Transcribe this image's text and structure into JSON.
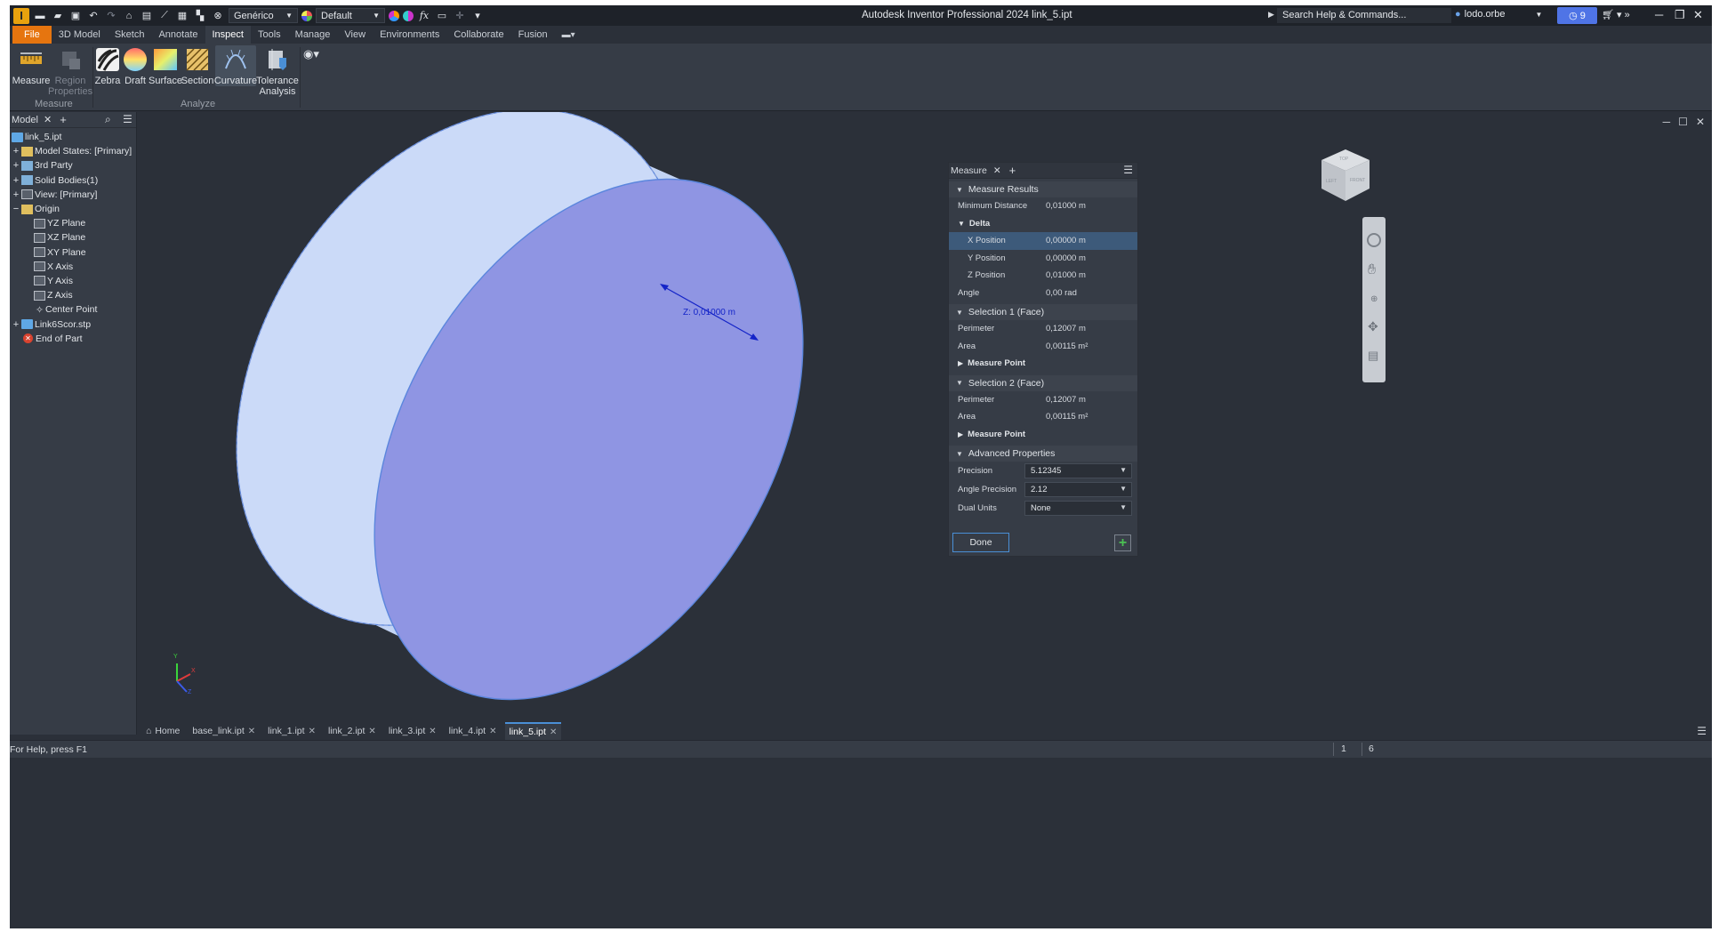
{
  "titlebar": {
    "app_logo": "I",
    "appearance_select": "Genérico",
    "visual_style_select": "Default",
    "function_glyph": "fx",
    "window_title": "Autodesk Inventor Professional 2024   link_5.ipt",
    "search_placeholder": "Search Help & Commands...",
    "user_name": "lodo.orbe",
    "notification_count": "9"
  },
  "ribbon_tabs": [
    "File",
    "3D Model",
    "Sketch",
    "Annotate",
    "Inspect",
    "Tools",
    "Manage",
    "View",
    "Environments",
    "Collaborate",
    "Fusion"
  ],
  "ribbon": {
    "measure": "Measure",
    "region_properties_1": "Region",
    "region_properties_2": "Properties",
    "zebra": "Zebra",
    "draft": "Draft",
    "surface": "Surface",
    "section": "Section",
    "curvature": "Curvature",
    "tolerance_1": "Tolerance",
    "tolerance_2": "Analysis",
    "group_measure": "Measure",
    "group_analyze": "Analyze"
  },
  "browser": {
    "tab_label": "Model",
    "items": [
      "link_5.ipt",
      "Model States: [Primary]",
      "3rd Party",
      "Solid Bodies(1)",
      "View: [Primary]",
      "Origin",
      "YZ Plane",
      "XZ Plane",
      "XY Plane",
      "X Axis",
      "Y Axis",
      "Z Axis",
      "Center Point",
      "Link6Scor.stp",
      "End of Part"
    ]
  },
  "viewport": {
    "dimension_label": "Z: 0,01000 m",
    "viewcube_face_left": "LEFT",
    "viewcube_face_front": "FRONT",
    "viewcube_face_top": "TOP",
    "triad_x": "X",
    "triad_y": "Y",
    "triad_z": "Z"
  },
  "measure_panel": {
    "title": "Measure",
    "section_results": "Measure Results",
    "min_distance_label": "Minimum Distance",
    "min_distance_value": "0,01000 m",
    "delta_label": "Delta",
    "x_label": "X Position",
    "x_value": "0,00000 m",
    "y_label": "Y Position",
    "y_value": "0,00000 m",
    "z_label": "Z Position",
    "z_value": "0,01000 m",
    "angle_label": "Angle",
    "angle_value": "0,00 rad",
    "section_sel1": "Selection 1 (Face)",
    "sel1_perimeter_label": "Perimeter",
    "sel1_perimeter_value": "0,12007 m",
    "sel1_area_label": "Area",
    "sel1_area_value": "0,00115 m²",
    "sel1_measure_point": "Measure Point",
    "section_sel2": "Selection 2 (Face)",
    "sel2_perimeter_label": "Perimeter",
    "sel2_perimeter_value": "0,12007 m",
    "sel2_area_label": "Area",
    "sel2_area_value": "0,00115 m²",
    "sel2_measure_point": "Measure Point",
    "section_advanced": "Advanced Properties",
    "precision_label": "Precision",
    "precision_value": "5.12345",
    "angle_precision_label": "Angle Precision",
    "angle_precision_value": "2.12",
    "dual_units_label": "Dual Units",
    "dual_units_value": "None",
    "done_label": "Done",
    "add_label": "+"
  },
  "doc_tabs": {
    "home": "Home",
    "tabs": [
      "base_link.ipt",
      "link_1.ipt",
      "link_2.ipt",
      "link_3.ipt",
      "link_4.ipt",
      "link_5.ipt"
    ]
  },
  "status": {
    "help_text": "For Help, press F1",
    "count_1": "1",
    "count_2": "6"
  },
  "colors": {
    "accent": "#4a8fd6",
    "file_tab": "#e6750f",
    "cylinder_side": "#c3d4f4",
    "cylinder_face": "#8f95e3",
    "notification": "#4f74e6"
  }
}
